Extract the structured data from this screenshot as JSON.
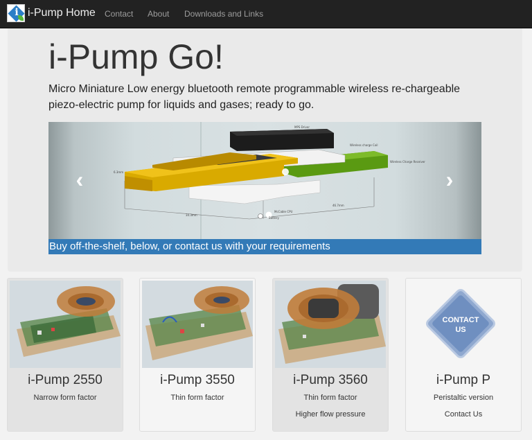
{
  "navbar": {
    "brand": "i-Pump Home",
    "links": [
      "Contact",
      "About",
      "Downloads and Links"
    ]
  },
  "hero": {
    "title": "i-Pump Go!",
    "lead": "Micro Miniature Low energy bluetooth remote programmable wireless re-chargeable piezo-electric pump for liquids and gases; ready to go.",
    "carousel_caption": "Buy off-the-shelf, below, or contact us with your requirements",
    "diagram_labels": [
      "MPS Driver",
      "Wireless charge Coil",
      "Wireless Charge Receiver",
      "6.3mm",
      "McCable CPU",
      "Battery",
      "34.3mm",
      "46.7mm"
    ]
  },
  "products": [
    {
      "name": "i-Pump 2550",
      "line1": "Narrow form factor",
      "line2": ""
    },
    {
      "name": "i-Pump 3550",
      "line1": "Thin form factor",
      "line2": ""
    },
    {
      "name": "i-Pump 3560",
      "line1": "Thin form factor",
      "line2": "Higher flow pressure"
    },
    {
      "name": "i-Pump P",
      "line1": "Peristaltic version",
      "line2": "Contact Us",
      "badge": "CONTACT US"
    }
  ],
  "colors": {
    "navbar": "#222222",
    "caption_bg": "#337ab7",
    "coil_gold": "#c9a000",
    "pcb_green": "#5a9a12"
  }
}
